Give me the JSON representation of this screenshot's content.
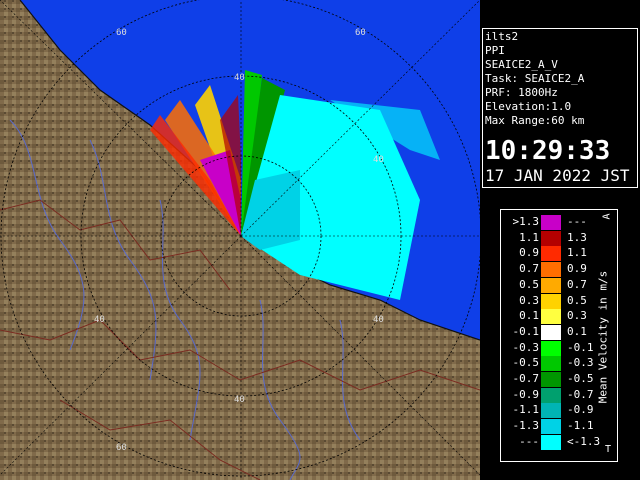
{
  "radar": {
    "background_color": "#0f3fe8",
    "land_color": "#806a4a",
    "range_labels": [
      "60",
      "40",
      "40",
      "40",
      "40",
      "40",
      "60",
      "60"
    ]
  },
  "info": {
    "lines": [
      "ilts2",
      "PPI",
      "SEAICE2_A_V",
      "Task: SEAICE2_A",
      "PRF: 1800Hz",
      "Elevation:1.0",
      "Max Range:60 km"
    ],
    "time": "10:29:33",
    "date": "17 JAN 2022 JST"
  },
  "legend": {
    "left_labels": [
      ">1.3",
      "1.1",
      "0.9",
      "0.7",
      "0.5",
      "0.3",
      "0.1",
      "-0.1",
      "-0.3",
      "-0.5",
      "-0.7",
      "-0.9",
      "-1.1",
      "-1.3",
      "---"
    ],
    "right_labels": [
      "---",
      "1.3",
      "1.1",
      "0.9",
      "0.7",
      "0.5",
      "0.3",
      "0.1",
      "-0.1",
      "-0.3",
      "-0.5",
      "-0.7",
      "-0.9",
      "-1.1",
      "<-1.3"
    ],
    "colors": [
      "#c800c8",
      "#b40000",
      "#ff2a00",
      "#ff6e00",
      "#ffaa00",
      "#ffd200",
      "#ffff40",
      "#ffffff",
      "#00ff00",
      "#00c800",
      "#009600",
      "#00a06e",
      "#00b4b4",
      "#00d2e6",
      "#00ffff"
    ],
    "unit": "Mean Velocity in m/s",
    "top_marker": "A",
    "bottom_marker": "T"
  }
}
